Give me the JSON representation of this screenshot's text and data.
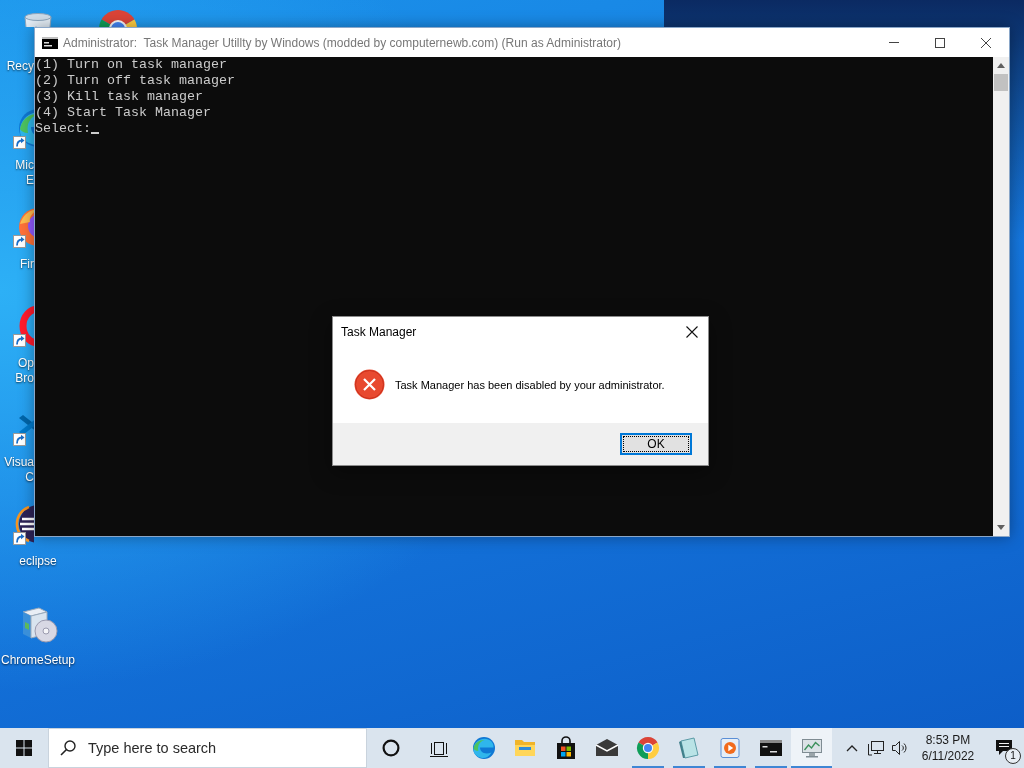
{
  "desktop": {
    "icons": [
      {
        "kind": "recycle-bin",
        "label_lines": [
          "Recy"
        ],
        "shortcut": false
      },
      {
        "kind": "edge",
        "label_lines": [
          "Mic",
          "E"
        ],
        "shortcut": true
      },
      {
        "kind": "firefox",
        "label_lines": [
          "Fir"
        ],
        "shortcut": true
      },
      {
        "kind": "opera",
        "label_lines": [
          "Op",
          "Bro"
        ],
        "shortcut": true
      },
      {
        "kind": "vscode",
        "label_lines": [
          "Visua",
          "C"
        ],
        "shortcut": true
      },
      {
        "kind": "eclipse",
        "label_lines": [
          "eclipse"
        ],
        "shortcut": true
      },
      {
        "kind": "installer",
        "label_lines": [
          "ChromeSetup"
        ],
        "shortcut": false
      },
      {
        "kind": "chrome",
        "shortcut": false
      }
    ]
  },
  "console_window": {
    "title": "Administrator:  Task Manager Utillty by Windows (modded by computernewb.com) (Run as Administrator)",
    "active": false,
    "lines": [
      "(1) Turn on task manager",
      "(2) Turn off task manager",
      "(3) Kill task manager",
      "(4) Start Task Manager"
    ],
    "prompt": "Select:"
  },
  "dialog": {
    "title": "Task Manager",
    "active": true,
    "kind": "error",
    "message": "Task Manager has been disabled by your administrator.",
    "buttons": [
      {
        "label": "OK",
        "focused": true
      }
    ]
  },
  "taskbar": {
    "search": {
      "placeholder": "Type here to search"
    },
    "apps": [
      {
        "kind": "edge",
        "running": false,
        "selected": false
      },
      {
        "kind": "explorer",
        "running": false,
        "selected": false
      },
      {
        "kind": "store",
        "running": false,
        "selected": false
      },
      {
        "kind": "mail",
        "running": false,
        "selected": false
      },
      {
        "kind": "chrome",
        "running": true,
        "selected": false
      },
      {
        "kind": "notepad",
        "running": true,
        "selected": false
      },
      {
        "kind": "media",
        "running": true,
        "selected": false
      },
      {
        "kind": "terminal",
        "running": true,
        "selected": false
      },
      {
        "kind": "monitor",
        "running": true,
        "selected": true
      }
    ],
    "clock": {
      "time": "8:53 PM",
      "date": "6/11/2022"
    },
    "notification_count": "1"
  }
}
